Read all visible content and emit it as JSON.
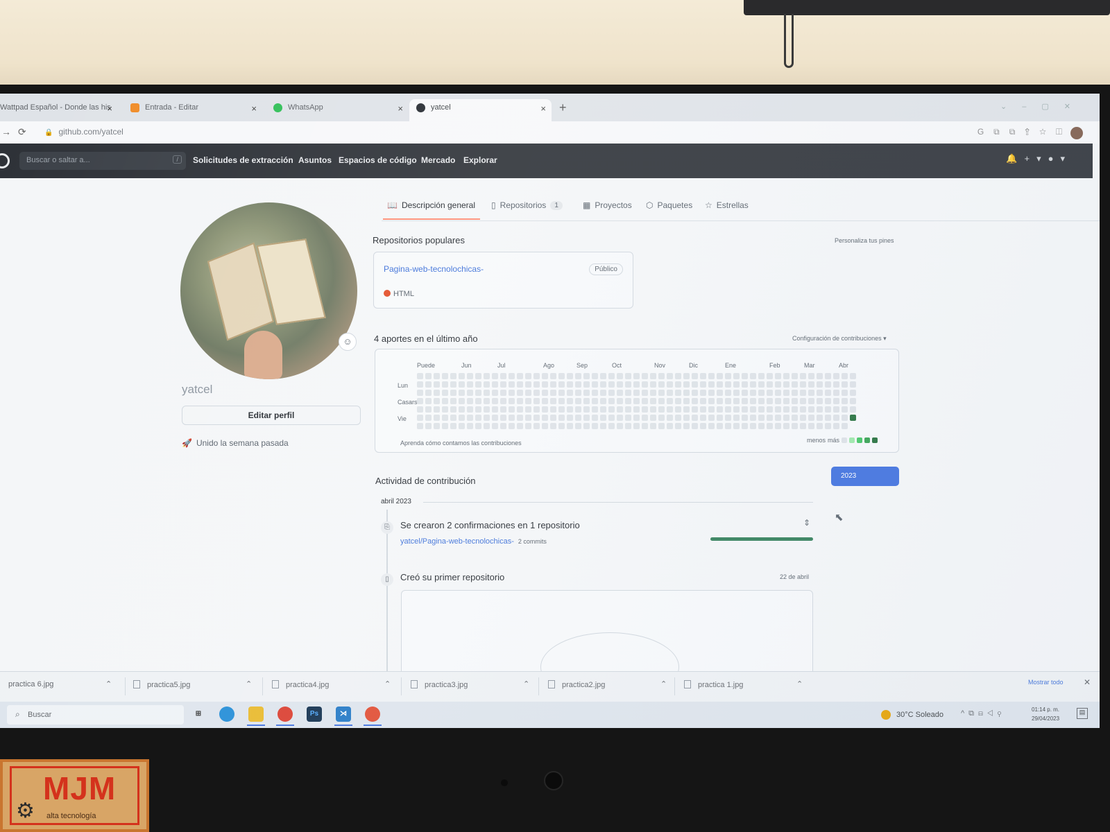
{
  "browser": {
    "tabs": [
      {
        "label": "Wattpad Español - Donde las his",
        "icon": "wattpad-icon",
        "active": false
      },
      {
        "label": "Entrada - Editar",
        "icon": "blogger-icon",
        "active": false
      },
      {
        "label": "WhatsApp",
        "icon": "whatsapp-icon",
        "active": false
      },
      {
        "label": "yatcel",
        "icon": "github-icon",
        "active": true
      }
    ],
    "close_glyph": "×",
    "new_tab_glyph": "+",
    "url": "github.com/yatcel"
  },
  "github": {
    "search_placeholder": "Buscar o saltar a...",
    "search_shortcut": "/",
    "nav": [
      "Solicitudes de extracción",
      "Asuntos",
      "Espacios de código",
      "Mercado",
      "Explorar"
    ]
  },
  "profile": {
    "username": "yatcel",
    "edit_button": "Editar perfil",
    "joined": "Unido la semana pasada",
    "tabs": [
      {
        "label": "Descripción general",
        "icon": "book-icon",
        "active": true
      },
      {
        "label": "Repositorios",
        "icon": "repo-icon",
        "count": "1"
      },
      {
        "label": "Proyectos",
        "icon": "table-icon"
      },
      {
        "label": "Paquetes",
        "icon": "package-icon"
      },
      {
        "label": "Estrellas",
        "icon": "star-icon"
      }
    ]
  },
  "popular": {
    "title": "Repositorios populares",
    "customize": "Personaliza tus pines",
    "repo": {
      "name": "Pagina-web-tecnolochicas-",
      "visibility": "Público",
      "language": "HTML",
      "language_color": "#e34c26"
    }
  },
  "contributions": {
    "title": "4 aportes en el último año",
    "settings": "Configuración de contribuciones ▾",
    "months": [
      "Puede",
      "Jun",
      "Jul",
      "Ago",
      "Sep",
      "Oct",
      "Nov",
      "Dic",
      "Ene",
      "Feb",
      "Mar",
      "Abr"
    ],
    "days": [
      "Lun",
      "Casarse",
      "Vie"
    ],
    "learn": "Aprenda cómo contamos las contribuciones",
    "legend_less": "menos",
    "legend_more": "más",
    "legend_colors": [
      "#dde2e7",
      "#9be9a8",
      "#40c463",
      "#30a14e",
      "#216e39"
    ],
    "filled_cells": [
      {
        "week": 52,
        "day": 5,
        "level": 4
      }
    ],
    "empty_color": "#dde2e7"
  },
  "activity": {
    "title": "Actividad de contribución",
    "year": "2023",
    "month": "abril 2023",
    "event1": {
      "title": "Se crearon 2 confirmaciones en 1 repositorio",
      "repo": "yatcel/Pagina-web-tecnolochicas-",
      "commits": "2 commits",
      "progress": 1.0
    },
    "event2": {
      "title": "Creó su primer repositorio",
      "date": "22 de abril"
    }
  },
  "downloads": {
    "files": [
      "practica 6.jpg",
      "practica5.jpg",
      "practica4.jpg",
      "practica3.jpg",
      "practica2.jpg",
      "practica 1.jpg"
    ],
    "show_all": "Mostrar todo",
    "close_glyph": "✕"
  },
  "taskbar": {
    "search": "Buscar",
    "weather": "30°C  Soleado",
    "time": "01:14 p. m.",
    "date": "29/04/2023"
  },
  "sticker": {
    "title": "MJM",
    "subtitle": "alta tecnología"
  }
}
